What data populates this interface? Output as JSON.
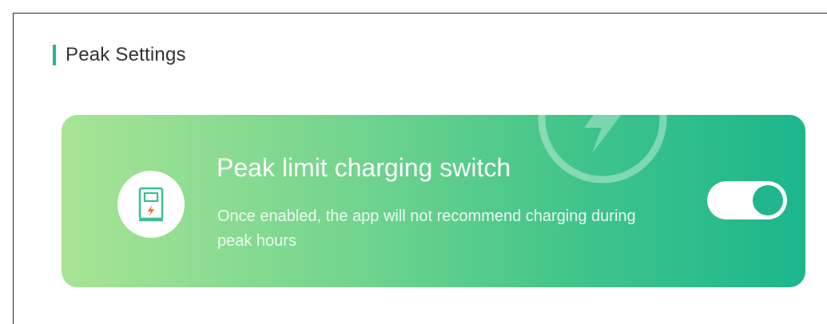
{
  "section": {
    "title": "Peak Settings"
  },
  "peak_limit_card": {
    "title": "Peak limit charging switch",
    "description": "Once enabled, the app will not recommend charging during peak hours",
    "icon": "charging-station-icon",
    "watermark_icon": "lightning-bolt-icon",
    "toggle_state": "on"
  },
  "colors": {
    "accent": "#1fb894",
    "gradient_start": "#a8e495",
    "gradient_end": "#1cb68d",
    "toggle_knob": "#21b68d"
  }
}
